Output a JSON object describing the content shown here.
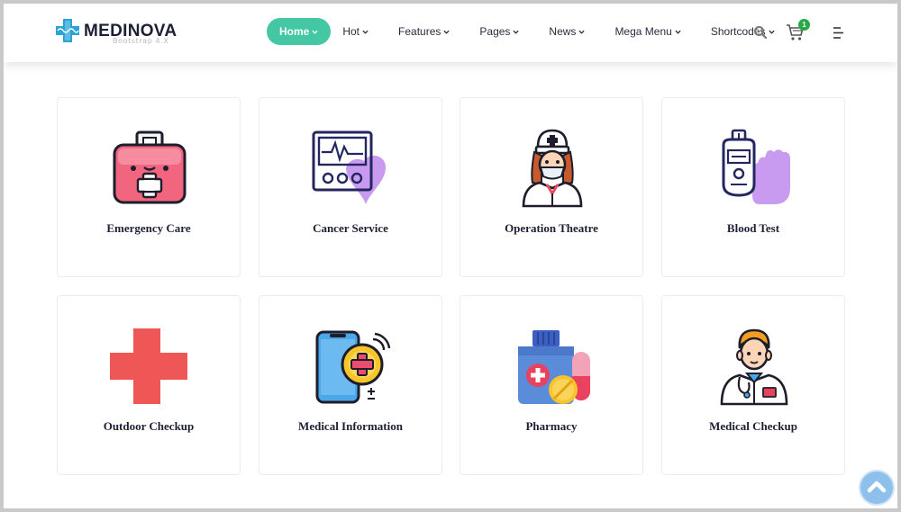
{
  "brand": {
    "name": "MEDINOVA",
    "tagline": "Bootstrap 4.X",
    "accent": "#43c8a3"
  },
  "nav": {
    "items": [
      {
        "label": "Home",
        "active": true
      },
      {
        "label": "Hot"
      },
      {
        "label": "Features"
      },
      {
        "label": "Pages"
      },
      {
        "label": "News"
      },
      {
        "label": "Mega Menu"
      },
      {
        "label": "Shortcodes"
      }
    ]
  },
  "header": {
    "cart_count": "1",
    "icons": [
      "search-icon",
      "cart-icon",
      "menu-icon"
    ]
  },
  "services": [
    {
      "title": "Emergency Care",
      "icon": "first-aid-kit-icon"
    },
    {
      "title": "Cancer Service",
      "icon": "heart-monitor-icon"
    },
    {
      "title": "Operation Theatre",
      "icon": "nurse-icon"
    },
    {
      "title": "Blood Test",
      "icon": "glucometer-icon"
    },
    {
      "title": "Outdoor Checkup",
      "icon": "red-cross-icon"
    },
    {
      "title": "Medical Information",
      "icon": "medical-phone-icon"
    },
    {
      "title": "Pharmacy",
      "icon": "medicine-bottle-icon"
    },
    {
      "title": "Medical Checkup",
      "icon": "doctor-icon"
    }
  ],
  "scroll_top_icon": "chevron-up-icon"
}
